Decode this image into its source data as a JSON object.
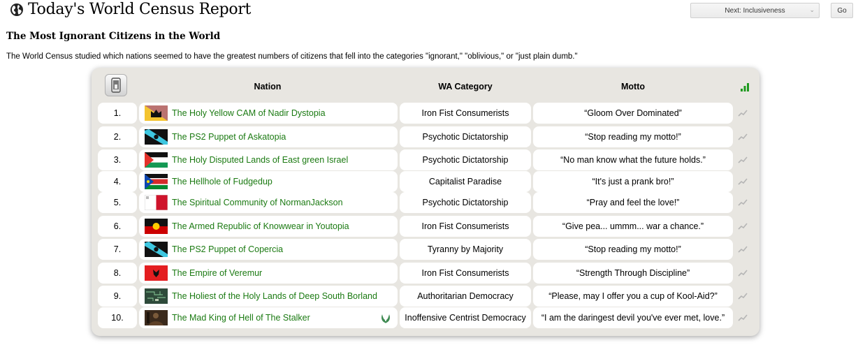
{
  "header": {
    "title": "Today's World Census Report",
    "next_select_value": "Next: Inclusiveness",
    "go_label": "Go"
  },
  "report": {
    "heading": "The Most Ignorant Citizens in the World",
    "description": "The World Census studied which nations seemed to have the greatest numbers of citizens that fell into the categories \"ignorant,\" \"oblivious,\" or \"just plain dumb.\""
  },
  "table": {
    "columns": {
      "nation": "Nation",
      "category": "WA Category",
      "motto": "Motto"
    },
    "rows": [
      {
        "rank": "1.",
        "nation": "The Holy Yellow CAM of Nadir Dystopia",
        "category": "Iron Fist Consumerists",
        "motto": "“Gloom Over Dominated”",
        "flag": "crown-flag"
      },
      {
        "rank": "2.",
        "nation": "The PS2 Puppet of Askatopia",
        "category": "Psychotic Dictatorship",
        "motto": "“Stop reading my motto!”",
        "flag": "cyan-diagonal-flag"
      },
      {
        "rank": "3.",
        "nation": "The Holy Disputed Lands of East green Israel",
        "category": "Psychotic Dictatorship",
        "motto": "“No man know what the future holds.”",
        "flag": "palestine-flag"
      },
      {
        "rank": "4.",
        "nation": "The Hellhole of Fudgedup",
        "category": "Capitalist Paradise",
        "motto": "“It's just a prank bro!”",
        "flag": "south-sudan-flag"
      },
      {
        "rank": "5.",
        "nation": "The Spiritual Community of NormanJackson",
        "category": "Psychotic Dictatorship",
        "motto": "“Pray and feel the love!”",
        "flag": "malta-flag"
      },
      {
        "rank": "6.",
        "nation": "The Armed Republic of Knowwear in Youtopia",
        "category": "Iron Fist Consumerists",
        "motto": "“Give pea... ummm... war a chance.”",
        "flag": "aboriginal-flag"
      },
      {
        "rank": "7.",
        "nation": "The PS2 Puppet of Copercia",
        "category": "Tyranny by Majority",
        "motto": "“Stop reading my motto!”",
        "flag": "cyan-diagonal-flag"
      },
      {
        "rank": "8.",
        "nation": "The Empire of Veremur",
        "category": "Iron Fist Consumerists",
        "motto": "“Strength Through Discipline”",
        "flag": "albania-flag"
      },
      {
        "rank": "9.",
        "nation": "The Holiest of the Holy Lands of Deep South Borland",
        "category": "Authoritarian Democracy",
        "motto": "“Please, may I offer you a cup of Kool-Aid?”",
        "flag": "circuit-board-flag"
      },
      {
        "rank": "10.",
        "nation": "The Mad King of Hell of The Stalker",
        "category": "Inoffensive Centrist Democracy",
        "motto": "“I am the daringest devil you've ever met, love.”",
        "flag": "photo-flag",
        "wa_badge": true
      }
    ]
  },
  "colors": {
    "nation_link": "#1b7a12",
    "panel_bg": "#e8e6e1",
    "signal": "#1f9a1f"
  },
  "icons": {
    "title": "globe-icon",
    "table_corner": "phone-icon",
    "header_right": "signal-bars-icon",
    "row_trend": "trend-line-icon",
    "wa_member": "wa-laurel-icon"
  }
}
